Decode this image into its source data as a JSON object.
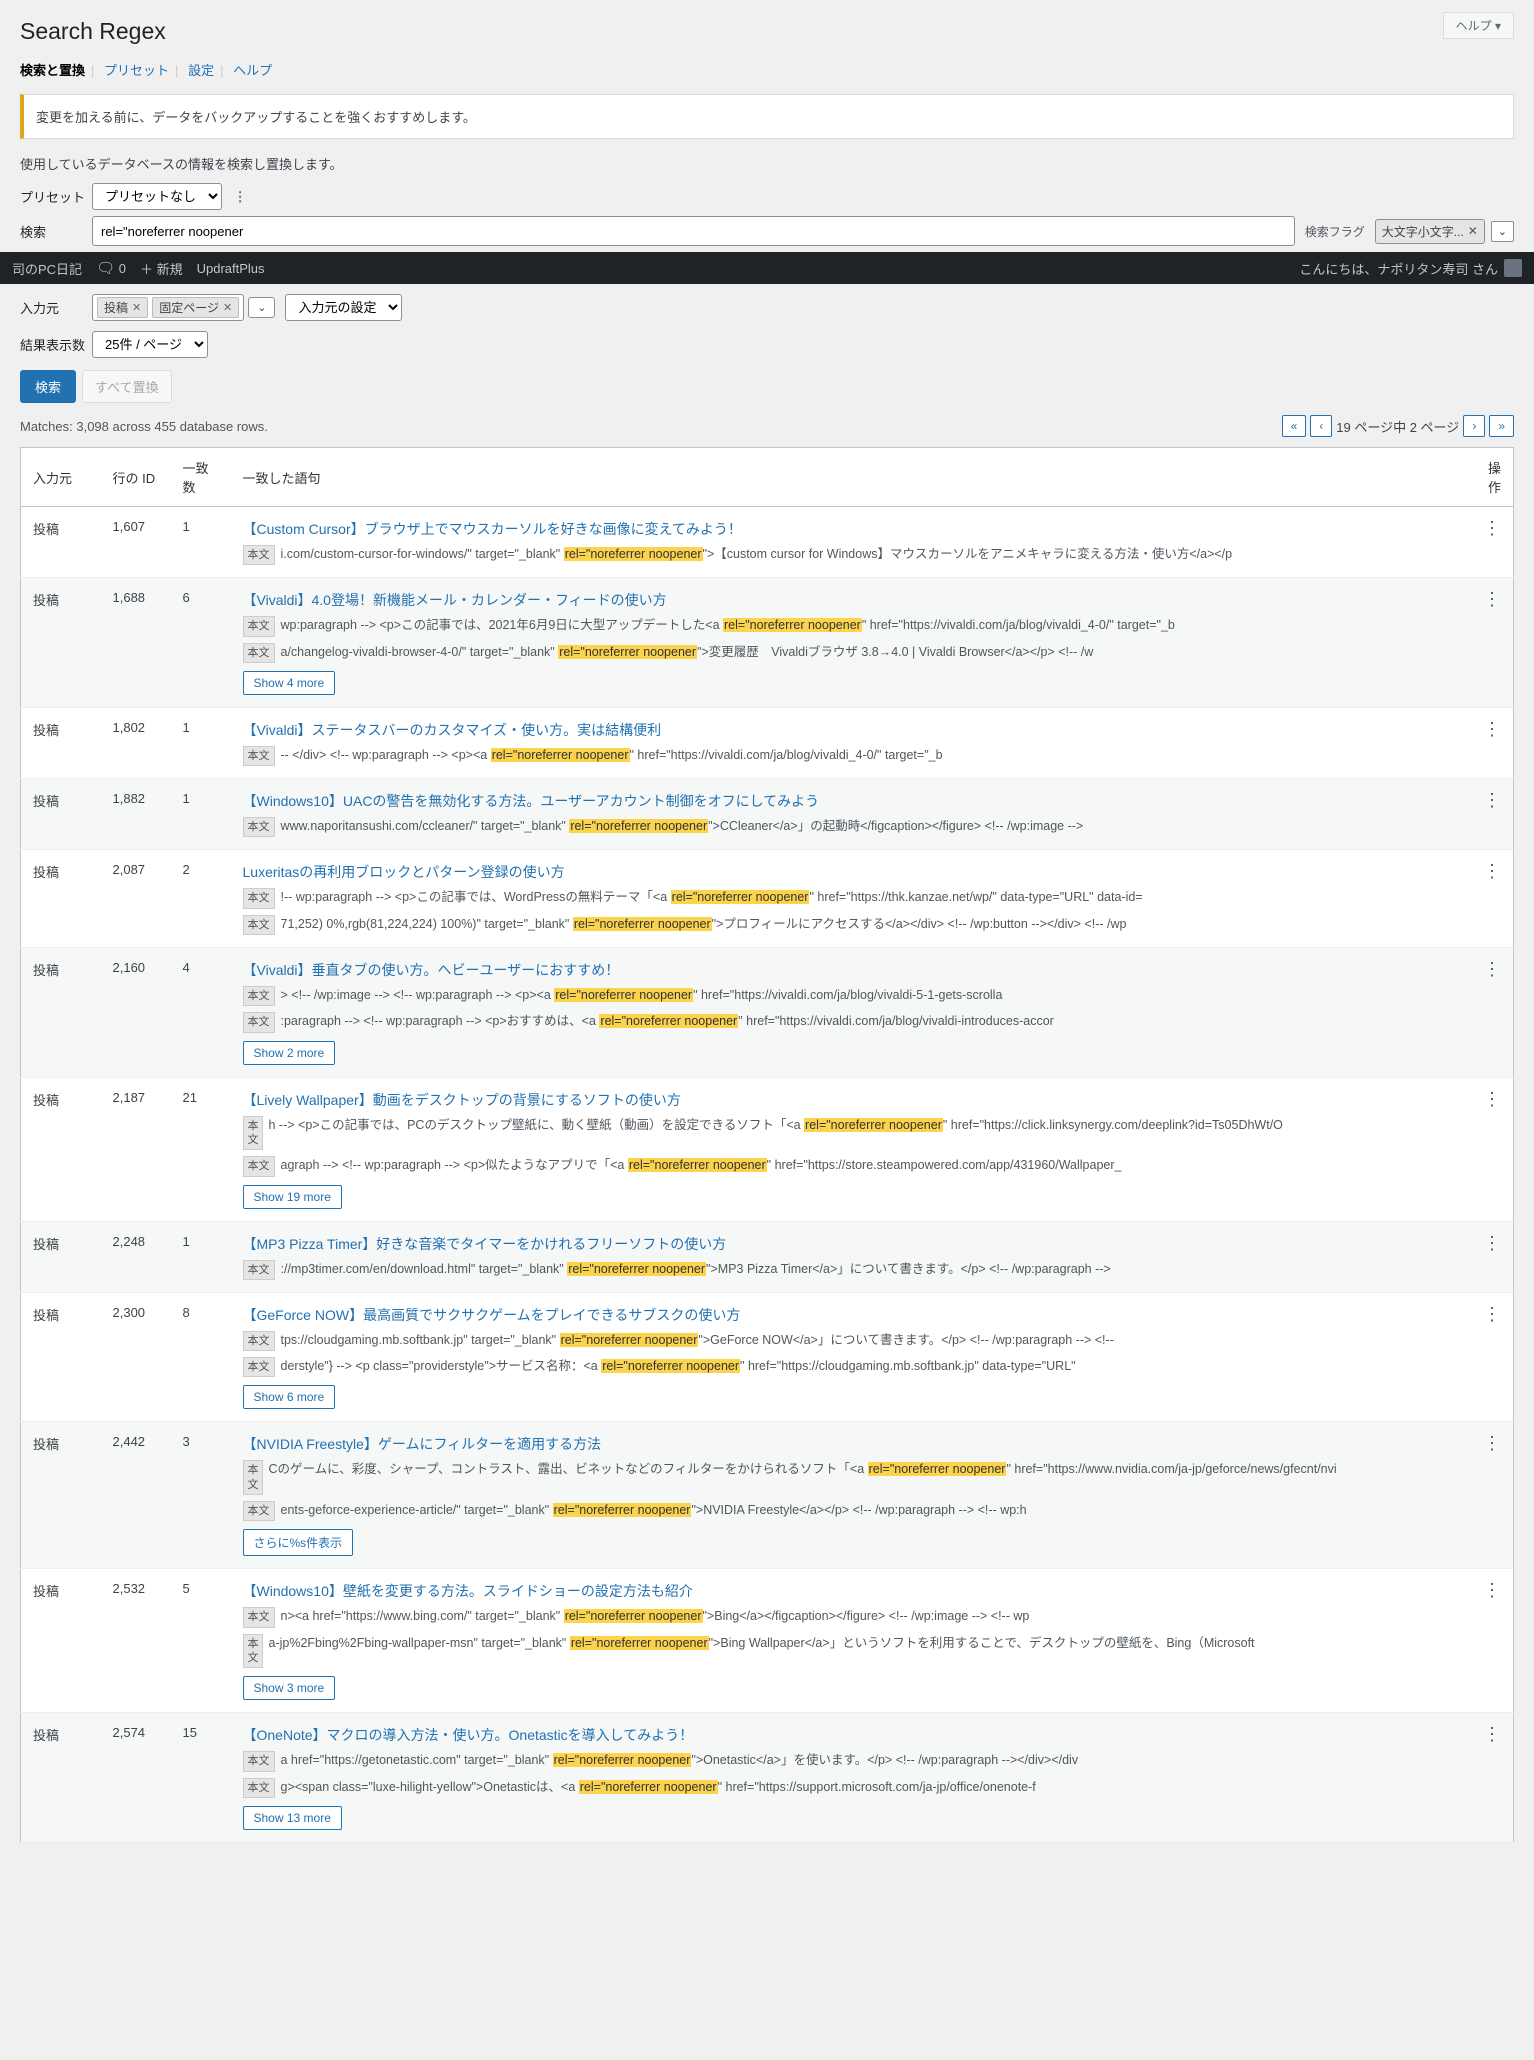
{
  "help_button": "ヘルプ",
  "page_title": "Search Regex",
  "tabs": {
    "search": "検索と置換",
    "preset": "プリセット",
    "settings": "設定",
    "help": "ヘルプ"
  },
  "notice": "変更を加える前に、データをバックアップすることを強くおすすめします。",
  "intro": "使用しているデータベースの情報を検索し置換します。",
  "labels": {
    "preset": "プリセット",
    "search": "検索",
    "source": "入力元",
    "results": "結果表示数",
    "flag": "検索フラグ",
    "source_settings": "入力元の設定"
  },
  "preset_select": "プリセットなし",
  "search_value": "rel=\"noreferrer noopener",
  "flag_chip": "大文字小文字...",
  "adminbar": {
    "site": "司のPC日記",
    "comments": "0",
    "new": "新規",
    "updraft": "UpdraftPlus",
    "greeting": "こんにちは、ナポリタン寿司 さん"
  },
  "source_pills": [
    "投稿",
    "固定ページ"
  ],
  "results_select": "25件 / ページ",
  "buttons": {
    "search": "検索",
    "replace_all": "すべて置換"
  },
  "matches_text": "Matches: 3,098 across 455 database rows.",
  "pager": {
    "prev2": "«",
    "prev": "‹",
    "text": "19 ページ中 2 ページ",
    "next": "›",
    "next2": "»"
  },
  "headers": {
    "src": "入力元",
    "id": "行の ID",
    "cnt": "一致数",
    "match": "一致した語句",
    "act": "操作"
  },
  "highlight": "rel=\"noreferrer noopener",
  "rows": [
    {
      "src": "投稿",
      "id": "1,607",
      "cnt": "1",
      "title": "【Custom Cursor】ブラウザ上でマウスカーソルを好きな画像に変えてみよう！",
      "snips": [
        {
          "b": "本文",
          "pre": "i.com/custom-cursor-for-windows/\" target=\"_blank\" ",
          "post": "\">【custom cursor for Windows】マウスカーソルをアニメキャラに変える方法・使い方</a></p"
        }
      ]
    },
    {
      "src": "投稿",
      "id": "1,688",
      "cnt": "6",
      "title": "【Vivaldi】4.0登場！新機能メール・カレンダー・フィードの使い方",
      "snips": [
        {
          "b": "本文",
          "pre": "wp:paragraph --> <p>この記事では、2021年6月9日に大型アップデートした<a ",
          "post": "\" href=\"https://vivaldi.com/ja/blog/vivaldi_4-0/\" target=\"_b"
        },
        {
          "b": "本文",
          "pre": "a/changelog-vivaldi-browser-4-0/\" target=\"_blank\" ",
          "post": "\">変更履歴　Vivaldiブラウザ 3.8→4.0 | Vivaldi Browser</a></p> <!-- /w"
        }
      ],
      "more": "Show 4 more"
    },
    {
      "src": "投稿",
      "id": "1,802",
      "cnt": "1",
      "title": "【Vivaldi】ステータスバーのカスタマイズ・使い方。実は結構便利",
      "snips": [
        {
          "b": "本文",
          "pre": "-- </div> <!-- wp:paragraph --> <p><a ",
          "post": "\" href=\"https://vivaldi.com/ja/blog/vivaldi_4-0/\" target=\"_b"
        }
      ]
    },
    {
      "src": "投稿",
      "id": "1,882",
      "cnt": "1",
      "title": "【Windows10】UACの警告を無効化する方法。ユーザーアカウント制御をオフにしてみよう",
      "snips": [
        {
          "b": "本文",
          "pre": "www.naporitansushi.com/ccleaner/\" target=\"_blank\" ",
          "post": "\">CCleaner</a>」の起動時</figcaption></figure> <!-- /wp:image -->"
        }
      ]
    },
    {
      "src": "投稿",
      "id": "2,087",
      "cnt": "2",
      "title": "Luxeritasの再利用ブロックとパターン登録の使い方",
      "snips": [
        {
          "b": "本文",
          "pre": "!-- wp:paragraph --> <p>この記事では、WordPressの無料テーマ「<a ",
          "post": "\" href=\"https://thk.kanzae.net/wp/\" data-type=\"URL\" data-id="
        },
        {
          "b": "本文",
          "pre": "71,252) 0%,rgb(81,224,224) 100%)\" target=\"_blank\" ",
          "post": "\">プロフィールにアクセスする</a></div> <!-- /wp:button --></div> <!-- /wp"
        }
      ]
    },
    {
      "src": "投稿",
      "id": "2,160",
      "cnt": "4",
      "title": "【Vivaldi】垂直タブの使い方。ヘビーユーザーにおすすめ！",
      "snips": [
        {
          "b": "本文",
          "pre": "> <!-- /wp:image --> <!-- wp:paragraph --> <p><a ",
          "post": "\" href=\"https://vivaldi.com/ja/blog/vivaldi-5-1-gets-scrolla"
        },
        {
          "b": "本文",
          "pre": ":paragraph --> <!-- wp:paragraph --> <p>おすすめは、<a ",
          "post": "\" href=\"https://vivaldi.com/ja/blog/vivaldi-introduces-accor"
        }
      ],
      "more": "Show 2 more"
    },
    {
      "src": "投稿",
      "id": "2,187",
      "cnt": "21",
      "title": "【Lively Wallpaper】動画をデスクトップの背景にするソフトの使い方",
      "snips": [
        {
          "b": "本文",
          "vert": true,
          "pre": "h --> <p>この記事では、PCのデスクトップ壁紙に、動く壁紙（動画）を設定できるソフト「<a ",
          "post": "\" href=\"https://click.linksynergy.com/deeplink?id=Ts05DhWt/O"
        },
        {
          "b": "本文",
          "pre": "agraph --> <!-- wp:paragraph --> <p>似たようなアプリで「<a ",
          "post": "\" href=\"https://store.steampowered.com/app/431960/Wallpaper_"
        }
      ],
      "more": "Show 19 more"
    },
    {
      "src": "投稿",
      "id": "2,248",
      "cnt": "1",
      "title": "【MP3 Pizza Timer】好きな音楽でタイマーをかけれるフリーソフトの使い方",
      "snips": [
        {
          "b": "本文",
          "pre": "://mp3timer.com/en/download.html\" target=\"_blank\" ",
          "post": "\">MP3 Pizza Timer</a>」について書きます。</p> <!-- /wp:paragraph -->"
        }
      ]
    },
    {
      "src": "投稿",
      "id": "2,300",
      "cnt": "8",
      "title": "【GeForce NOW】最高画質でサクサクゲームをプレイできるサブスクの使い方",
      "snips": [
        {
          "b": "本文",
          "pre": "tps://cloudgaming.mb.softbank.jp\" target=\"_blank\" ",
          "post": "\">GeForce NOW</a>」について書きます。</p> <!-- /wp:paragraph --> <!--"
        },
        {
          "b": "本文",
          "pre": "derstyle\"} --> <p class=\"providerstyle\">サービス名称：<a ",
          "post": "\" href=\"https://cloudgaming.mb.softbank.jp\" data-type=\"URL\""
        }
      ],
      "more": "Show 6 more"
    },
    {
      "src": "投稿",
      "id": "2,442",
      "cnt": "3",
      "title": "【NVIDIA Freestyle】ゲームにフィルターを適用する方法",
      "snips": [
        {
          "b": "本文",
          "vert": true,
          "pre": "Cのゲームに、彩度、シャープ、コントラスト、露出、ビネットなどのフィルターをかけられるソフト「<a ",
          "post": "\" href=\"https://www.nvidia.com/ja-jp/geforce/news/gfecnt/nvi"
        },
        {
          "b": "本文",
          "pre": "ents-geforce-experience-article/\" target=\"_blank\" ",
          "post": "\">NVIDIA Freestyle</a></p> <!-- /wp:paragraph --> <!-- wp:h"
        }
      ],
      "more": "さらに%s件表示"
    },
    {
      "src": "投稿",
      "id": "2,532",
      "cnt": "5",
      "title": "【Windows10】壁紙を変更する方法。スライドショーの設定方法も紹介",
      "snips": [
        {
          "b": "本文",
          "pre": "n><a href=\"https://www.bing.com/\" target=\"_blank\" ",
          "post": "\">Bing</a></figcaption></figure> <!-- /wp:image --> <!-- wp"
        },
        {
          "b": "本文",
          "vert": true,
          "pre": "a-jp%2Fbing%2Fbing-wallpaper-msn\" target=\"_blank\" ",
          "post": "\">Bing Wallpaper</a>」というソフトを利用することで、デスクトップの壁紙を、Bing（Microsoft"
        }
      ],
      "more": "Show 3 more"
    },
    {
      "src": "投稿",
      "id": "2,574",
      "cnt": "15",
      "title": "【OneNote】マクロの導入方法・使い方。Onetasticを導入してみよう！",
      "snips": [
        {
          "b": "本文",
          "pre": "a href=\"https://getonetastic.com\" target=\"_blank\" ",
          "post": "\">Onetastic</a>」を使います。</p> <!-- /wp:paragraph --></div></div"
        },
        {
          "b": "本文",
          "pre": "g><span class=\"luxe-hilight-yellow\">Onetasticは、<a ",
          "post": "\" href=\"https://support.microsoft.com/ja-jp/office/onenote-f"
        }
      ],
      "more": "Show 13 more"
    }
  ]
}
